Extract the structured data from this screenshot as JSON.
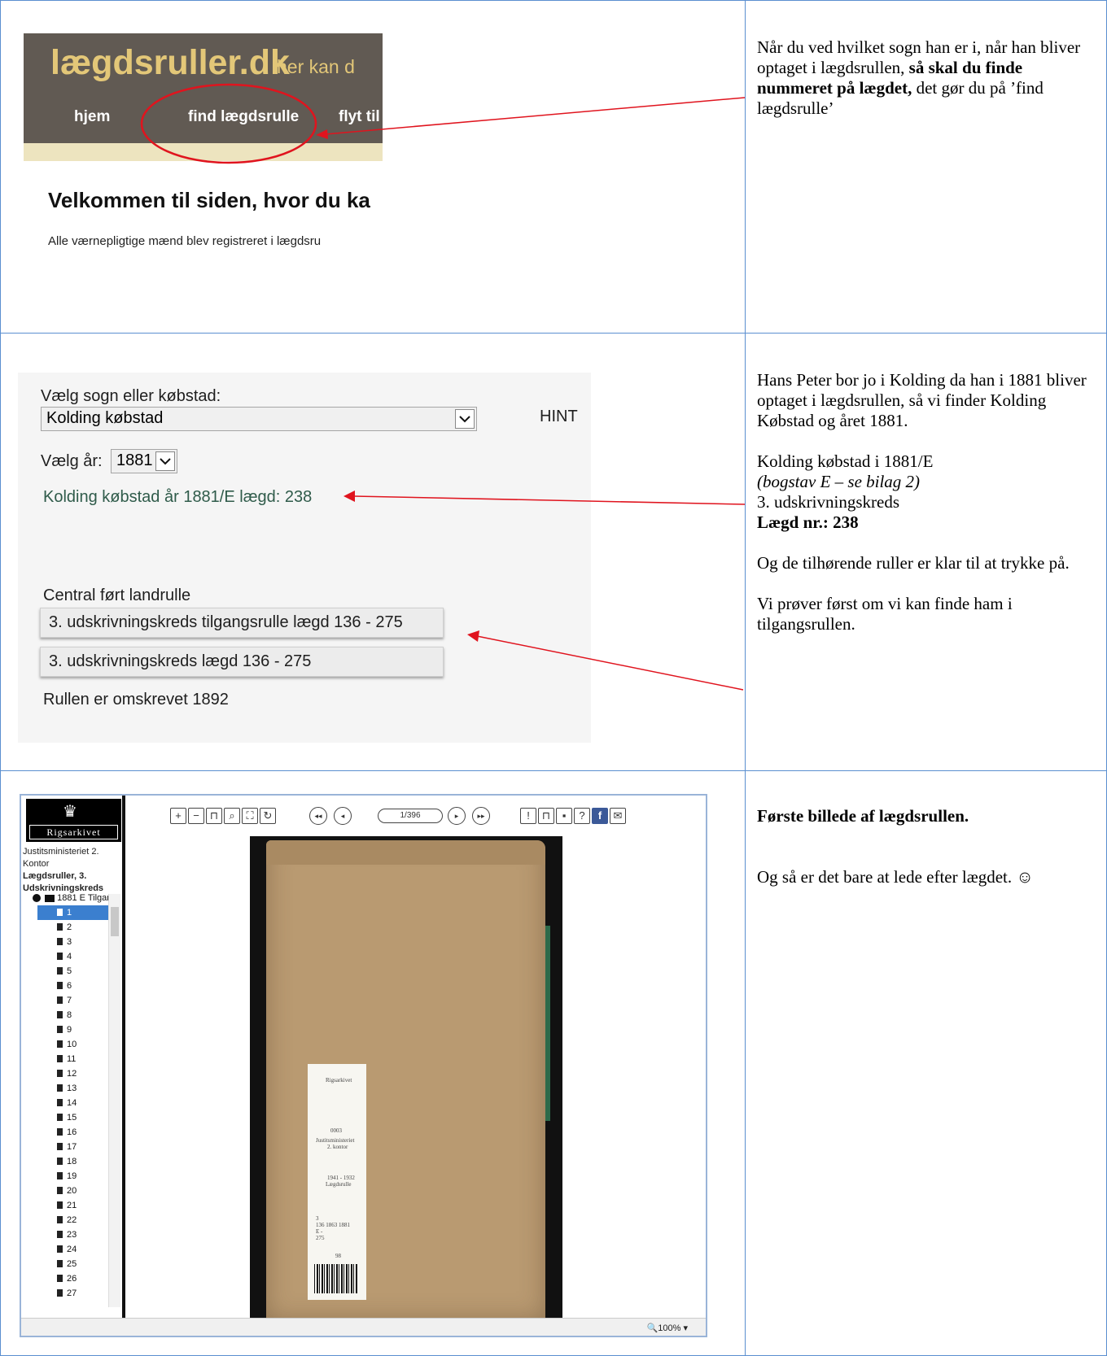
{
  "row1": {
    "site": {
      "logo": "lægdsruller.dk",
      "tagline": "her kan d",
      "nav": [
        "hjem",
        "find lægdsrulle",
        "flyt til"
      ],
      "heading": "Velkommen til siden, hvor du ka",
      "intro": "Alle værnepligtige mænd blev registreret i lægdsru"
    },
    "note": {
      "text_before": "Når du ved hvilket sogn han er i, når han bliver optaget i lægdsrullen, ",
      "bold": "så skal du finde nummeret på lægdet,",
      "text_after": " det gør du på ’find lægdsrulle’"
    }
  },
  "row2": {
    "form": {
      "parish_label": "Vælg sogn eller købstad:",
      "parish_value": "Kolding købstad",
      "hint": "HINT",
      "year_label": "Vælg år:",
      "year_value": "1881",
      "result": "Kolding købstad år 1881/E lægd: 238",
      "section_label": "Central ført landrulle",
      "roll_1": "3. udskrivningskreds tilgangsrulle lægd 136 - 275",
      "roll_2": "3. udskrivningskreds lægd 136 - 275",
      "rewritten": "Rullen er omskrevet 1892"
    },
    "note": {
      "p1": "Hans Peter bor jo i Kolding da han i 1881 bliver optaget i lægdsrullen, så vi finder Kolding Købstad og året 1881.",
      "line1": "Kolding købstad i 1881/E",
      "line2": "(bogstav E – se bilag 2)",
      "line3": "3. udskrivningskreds",
      "line4": "Lægd nr.: 238",
      "p3": "Og de tilhørende ruller er klar til at trykke på.",
      "p4": "Vi prøver først om vi kan finde ham i tilgangsrullen."
    }
  },
  "row3": {
    "viewer": {
      "logo_text": "Rigsarkivet",
      "crumb_1": "Justitsministeriet 2. Kontor",
      "crumb_2": "Lægdsruller, 3. Udskrivningskreds",
      "folder": "1881 E Tilgan",
      "items": [
        "1",
        "2",
        "3",
        "4",
        "5",
        "6",
        "7",
        "8",
        "9",
        "10",
        "11",
        "12",
        "13",
        "14",
        "15",
        "16",
        "17",
        "18",
        "19",
        "20",
        "21",
        "22",
        "23",
        "24",
        "25",
        "26",
        "27"
      ],
      "page_indicator": "1/396",
      "zoom": "100%",
      "label": {
        "l1": "Rigsarkivet",
        "l2": "0003",
        "l3": "Justitsministeriet",
        "l4": "2. kontor",
        "l5": "1941 - 1932",
        "l6": "Lægdsrulle",
        "l7": "3",
        "l8": "136  1863  1881",
        "l9": "E  -",
        "l10": "275",
        "l11": "98"
      }
    },
    "note": {
      "heading": "Første billede af lægdsrullen.",
      "p1": "Og så er det bare at lede efter lægdet. ☺"
    }
  },
  "colors": {
    "grid": "#5b8fd0",
    "annotation": "#e0141e",
    "site_header": "#615a53",
    "logo": "#e3c778"
  }
}
